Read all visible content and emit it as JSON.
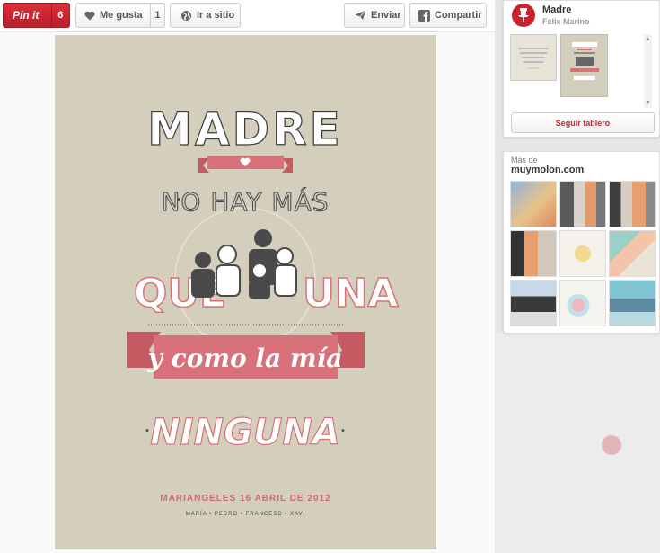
{
  "toolbar": {
    "pinit_label": "Pin it",
    "pinit_count": "6",
    "like_label": "Me gusta",
    "like_count": "1",
    "visit_label": "Ir a sitio",
    "send_label": "Enviar",
    "share_label": "Compartir"
  },
  "poster": {
    "line1": "MADRE",
    "line2": "NO HAY MÁS",
    "line3_left": "QUE",
    "line3_right": "UNA",
    "line4": "y como la mía",
    "line5": "NINGUNA",
    "credit_main": "MARIANGELES 16 ABRIL DE 2012",
    "credit_names": "MARÍA • PEDRO • FRANCESC • XAVI"
  },
  "board": {
    "title": "Madre",
    "author": "Félix Marino",
    "follow_label": "Seguir tablero"
  },
  "more": {
    "label": "Más de",
    "source": "muymolon.com"
  },
  "colors": {
    "pinterest_red": "#c8232c",
    "poster_bg": "#d4cebd",
    "poster_pink": "#d9717a"
  }
}
